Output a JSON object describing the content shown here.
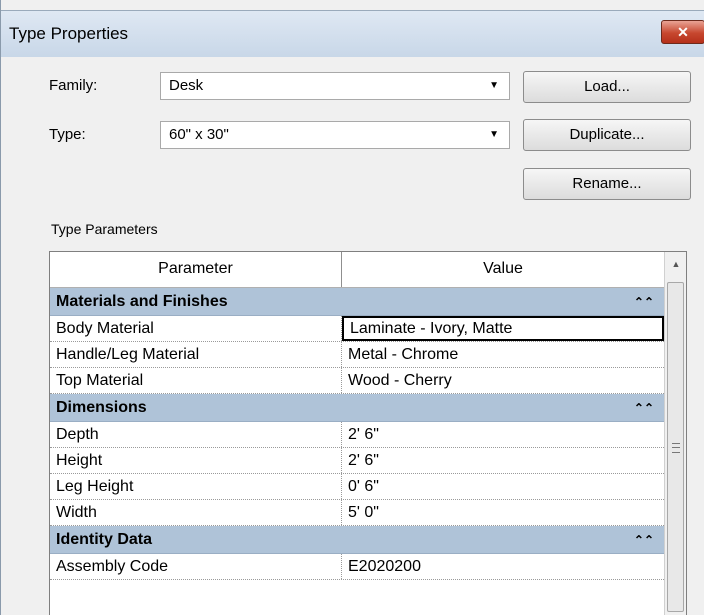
{
  "window": {
    "title": "Type Properties",
    "close_glyph": "✕"
  },
  "family": {
    "label": "Family:",
    "value": "Desk"
  },
  "type": {
    "label": "Type:",
    "value": "60\" x 30\""
  },
  "buttons": {
    "load": "Load...",
    "duplicate": "Duplicate...",
    "rename": "Rename..."
  },
  "section_label": "Type Parameters",
  "table": {
    "headers": {
      "parameter": "Parameter",
      "value": "Value"
    },
    "groups": [
      {
        "name": "Materials and Finishes",
        "rows": [
          {
            "param": "Body Material",
            "value": "Laminate - Ivory, Matte"
          },
          {
            "param": "Handle/Leg Material",
            "value": "Metal - Chrome"
          },
          {
            "param": "Top Material",
            "value": "Wood - Cherry"
          }
        ]
      },
      {
        "name": "Dimensions",
        "rows": [
          {
            "param": "Depth",
            "value": "2'  6\""
          },
          {
            "param": "Height",
            "value": "2'  6\""
          },
          {
            "param": "Leg Height",
            "value": "0'  6\""
          },
          {
            "param": "Width",
            "value": "5'  0\""
          }
        ]
      },
      {
        "name": "Identity Data",
        "rows": [
          {
            "param": "Assembly Code",
            "value": "E2020200"
          }
        ]
      }
    ]
  },
  "icons": {
    "dropdown": "▼",
    "collapse": "⌃⌃",
    "scroll_up": "▲"
  }
}
